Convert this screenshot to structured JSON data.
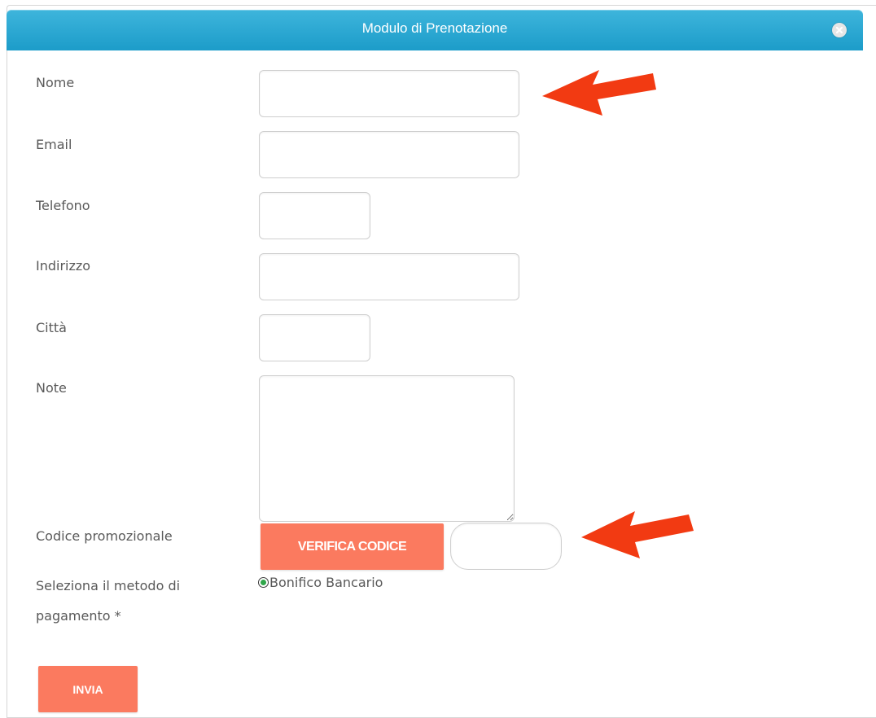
{
  "dialog": {
    "title": "Modulo di Prenotazione",
    "close_icon": "close-circle-icon"
  },
  "form": {
    "name_label": "Nome",
    "email_label": "Email",
    "phone_label": "Telefono",
    "address_label": "Indirizzo",
    "city_label": "Città",
    "notes_label": "Note",
    "promo_label": "Codice promozionale",
    "verify_button": "VERIFICA CODICE",
    "payment_label_line1": "Seleziona il metodo di",
    "payment_label_line2": "pagamento *",
    "payment_option": "Bonifico Bancario",
    "submit_button": "INVIA"
  },
  "colors": {
    "titlebar": "#1c9cc9",
    "button": "#fb7a5f",
    "arrow": "#f23a12",
    "radio_dot": "#2fa64a"
  }
}
